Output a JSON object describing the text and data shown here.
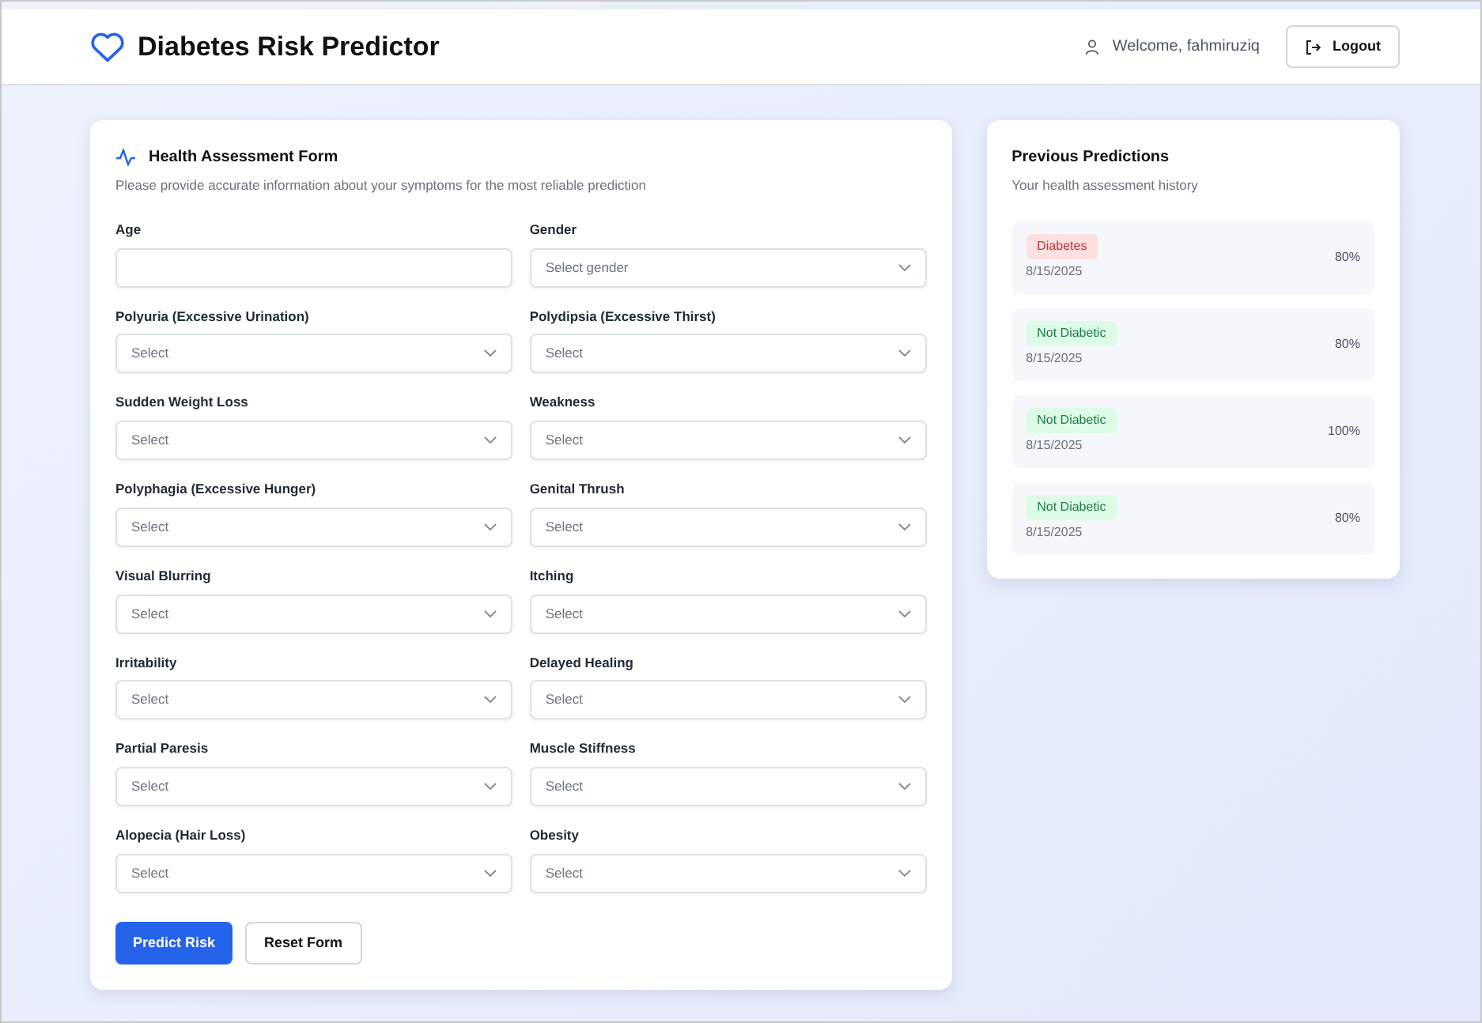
{
  "header": {
    "title": "Diabetes Risk Predictor",
    "welcome": "Welcome, fahmiruziq",
    "logout": "Logout"
  },
  "form": {
    "title": "Health Assessment Form",
    "subtitle": "Please provide accurate information about your symptoms for the most reliable prediction",
    "fields": [
      {
        "label": "Age",
        "kind": "text"
      },
      {
        "label": "Gender",
        "kind": "select",
        "placeholder": "Select gender"
      },
      {
        "label": "Polyuria (Excessive Urination)",
        "kind": "select",
        "placeholder": "Select"
      },
      {
        "label": "Polydipsia (Excessive Thirst)",
        "kind": "select",
        "placeholder": "Select"
      },
      {
        "label": "Sudden Weight Loss",
        "kind": "select",
        "placeholder": "Select"
      },
      {
        "label": "Weakness",
        "kind": "select",
        "placeholder": "Select"
      },
      {
        "label": "Polyphagia (Excessive Hunger)",
        "kind": "select",
        "placeholder": "Select"
      },
      {
        "label": "Genital Thrush",
        "kind": "select",
        "placeholder": "Select"
      },
      {
        "label": "Visual Blurring",
        "kind": "select",
        "placeholder": "Select"
      },
      {
        "label": "Itching",
        "kind": "select",
        "placeholder": "Select"
      },
      {
        "label": "Irritability",
        "kind": "select",
        "placeholder": "Select"
      },
      {
        "label": "Delayed Healing",
        "kind": "select",
        "placeholder": "Select"
      },
      {
        "label": "Partial Paresis",
        "kind": "select",
        "placeholder": "Select"
      },
      {
        "label": "Muscle Stiffness",
        "kind": "select",
        "placeholder": "Select"
      },
      {
        "label": "Alopecia (Hair Loss)",
        "kind": "select",
        "placeholder": "Select"
      },
      {
        "label": "Obesity",
        "kind": "select",
        "placeholder": "Select"
      }
    ],
    "buttons": [
      {
        "label": "Predict Risk",
        "kind": "primary"
      },
      {
        "label": "Reset Form",
        "kind": "secondary"
      }
    ]
  },
  "history": {
    "title": "Previous Predictions",
    "subtitle": "Your health assessment history",
    "items": [
      {
        "result": "Diabetes",
        "kind": "positive",
        "date": "8/15/2025",
        "confidence": "80%"
      },
      {
        "result": "Not Diabetic",
        "kind": "negative",
        "date": "8/15/2025",
        "confidence": "80%"
      },
      {
        "result": "Not Diabetic",
        "kind": "negative",
        "date": "8/15/2025",
        "confidence": "100%"
      },
      {
        "result": "Not Diabetic",
        "kind": "negative",
        "date": "8/15/2025",
        "confidence": "80%"
      }
    ]
  }
}
